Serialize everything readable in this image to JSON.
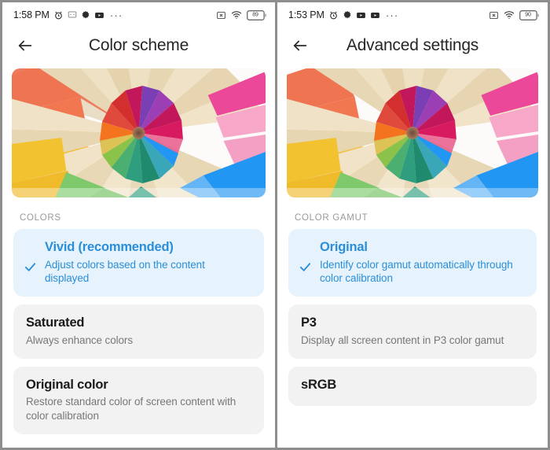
{
  "panels": [
    {
      "id": "color-scheme",
      "status_bar": {
        "time": "1:58 PM",
        "left_icons": [
          "alarm-clock-icon",
          "message-icon",
          "gear-icon",
          "video-icon"
        ],
        "overflow": "···",
        "right_icons": [
          "dnd-icon",
          "wifi-icon"
        ],
        "battery_level": "89"
      },
      "toolbar": {
        "back_icon": "back-arrow-icon",
        "title": "Color scheme"
      },
      "hero_image": "colored-pencils-radial",
      "section_label": "COLORS",
      "options": [
        {
          "title": "Vivid (recommended)",
          "desc": "Adjust colors based on the content displayed",
          "selected": true
        },
        {
          "title": "Saturated",
          "desc": "Always enhance colors",
          "selected": false
        },
        {
          "title": "Original color",
          "desc": "Restore standard color of screen content with color calibration",
          "selected": false
        }
      ]
    },
    {
      "id": "advanced-settings",
      "status_bar": {
        "time": "1:53 PM",
        "left_icons": [
          "alarm-clock-icon",
          "gear-icon",
          "video-icon",
          "video-icon"
        ],
        "overflow": "···",
        "right_icons": [
          "dnd-icon",
          "wifi-icon"
        ],
        "battery_level": "90"
      },
      "toolbar": {
        "back_icon": "back-arrow-icon",
        "title": "Advanced settings"
      },
      "hero_image": "colored-pencils-radial",
      "section_label": "COLOR GAMUT",
      "options": [
        {
          "title": "Original",
          "desc": "Identify color gamut automatically through color calibration",
          "selected": true
        },
        {
          "title": "P3",
          "desc": "Display all screen content in P3 color gamut",
          "selected": false
        },
        {
          "title": "sRGB",
          "desc": "",
          "selected": false
        }
      ]
    }
  ],
  "colors": {
    "accent": "#2a8ed8",
    "selected_card_bg": "#e6f3fc",
    "card_bg": "#f2f2f2",
    "title_text": "#1a1a1a",
    "desc_text": "#787878",
    "section_label": "#9a9a9a"
  }
}
